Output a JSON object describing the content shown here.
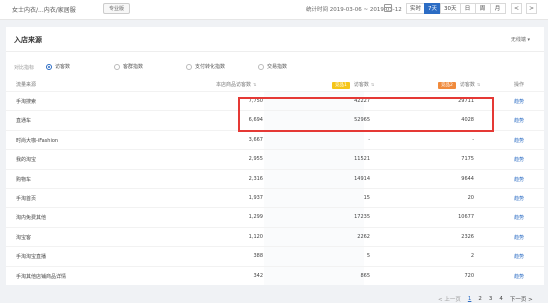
{
  "topbar": {
    "breadcrumb": "女士内衣/...内衣/家居服",
    "pro_badge": "专业版",
    "stat_time": "统计时间 2019-03-06 ~ 2019-03-12",
    "periods": [
      "实时",
      "7天",
      "30天",
      "日",
      "周",
      "月"
    ],
    "active_period": "7天",
    "icon_prev": "<",
    "icon_next": ">"
  },
  "panel": {
    "title": "入店来源",
    "wireless": "无线端",
    "filter_label": "对比指标",
    "metrics": [
      "访客数",
      "客群指数",
      "支付转化指数",
      "交易指数"
    ],
    "checked_metric": "访客数"
  },
  "table": {
    "headers": {
      "source": "流量来源",
      "mine": "本店商品访客数",
      "compare1_tag": "竞品1",
      "compare1": "访客数",
      "compare2_tag": "竞品2",
      "compare2": "访客数",
      "op": "操作"
    },
    "rows": [
      {
        "source": "手淘搜索",
        "mine": "7,750",
        "c1": "42227",
        "c2": "29711",
        "op": "趋势"
      },
      {
        "source": "直通车",
        "mine": "6,694",
        "c1": "52965",
        "c2": "4028",
        "op": "趋势"
      },
      {
        "source": "时尚大咖-iFashion",
        "mine": "3,667",
        "c1": "-",
        "c2": "-",
        "op": "趋势"
      },
      {
        "source": "我的淘宝",
        "mine": "2,955",
        "c1": "11521",
        "c2": "7175",
        "op": "趋势"
      },
      {
        "source": "购物车",
        "mine": "2,316",
        "c1": "14914",
        "c2": "9644",
        "op": "趋势"
      },
      {
        "source": "手淘首页",
        "mine": "1,937",
        "c1": "15",
        "c2": "20",
        "op": "趋势"
      },
      {
        "source": "淘内免费其他",
        "mine": "1,299",
        "c1": "17235",
        "c2": "10677",
        "op": "趋势"
      },
      {
        "source": "淘宝客",
        "mine": "1,120",
        "c1": "2262",
        "c2": "2326",
        "op": "趋势"
      },
      {
        "source": "手淘淘宝直播",
        "mine": "388",
        "c1": "5",
        "c2": "2",
        "op": "趋势"
      },
      {
        "source": "手淘其他店铺商品详情",
        "mine": "342",
        "c1": "865",
        "c2": "720",
        "op": "趋势"
      }
    ]
  },
  "pager": {
    "prev": "< 上一页",
    "pages": [
      "1",
      "2",
      "3",
      "4"
    ],
    "current": "1",
    "next": "下一页 >"
  }
}
